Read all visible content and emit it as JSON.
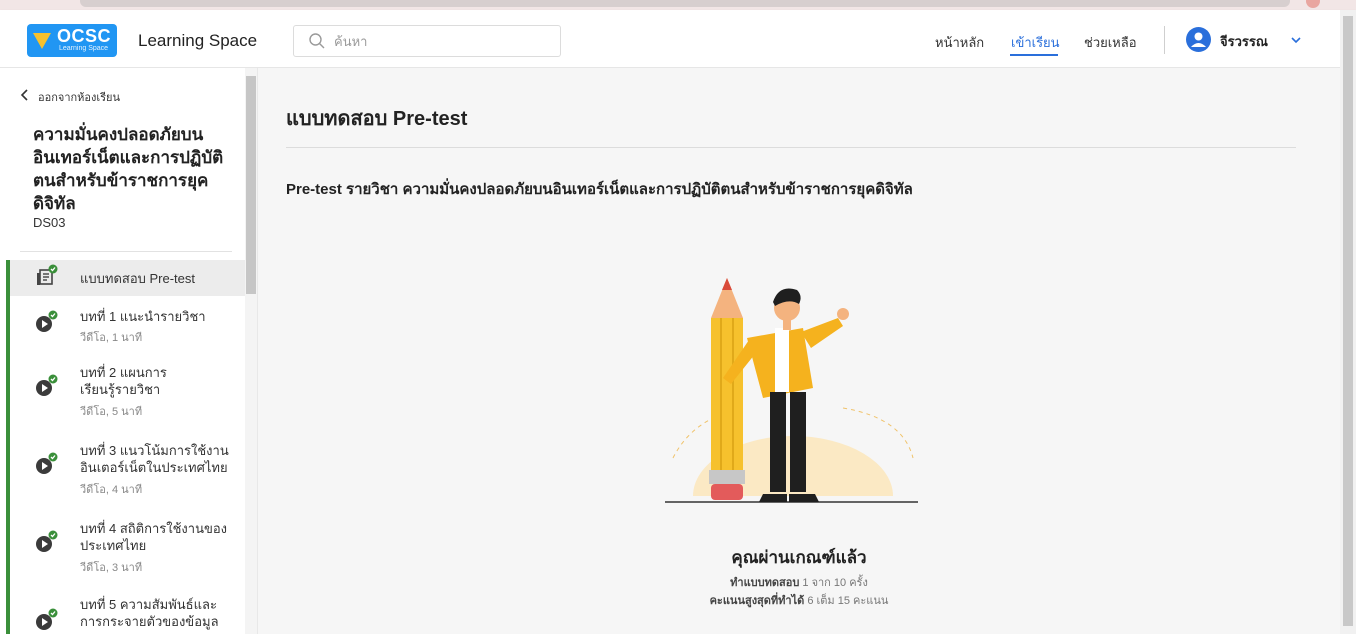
{
  "header": {
    "logo_text": "OCSC",
    "logo_sub": "Learning Space",
    "app_name": "Learning Space",
    "search_placeholder": "ค้นหา",
    "nav": [
      {
        "label": "หน้าหลัก",
        "active": false
      },
      {
        "label": "เข้าเรียน",
        "active": true
      },
      {
        "label": "ช่วยเหลือ",
        "active": false
      }
    ],
    "user_name": "จีรวรรณ"
  },
  "sidebar": {
    "back_label": "ออกจากห้องเรียน",
    "course_title": "ความมั่นคงปลอดภัยบนอินเทอร์เน็ตและการปฏิบัติตนสำหรับข้าราชการยุคดิจิทัล",
    "course_code": "DS03",
    "lessons": [
      {
        "title": "แบบทดสอบ Pre-test",
        "sub": "",
        "type": "quiz",
        "done": true,
        "active": true
      },
      {
        "title": "บทที่ 1 แนะนำรายวิชา",
        "sub": "วีดีโอ, 1 นาที",
        "type": "video",
        "done": true,
        "active": false
      },
      {
        "title": "บทที่ 2 แผนการเรียนรู้รายวิชา",
        "sub": "วีดีโอ, 5 นาที",
        "type": "video",
        "done": true,
        "active": false
      },
      {
        "title": "บทที่ 3 แนวโน้มการใช้งานอินเตอร์เน็ตในประเทศไทย",
        "sub": "วีดีโอ, 4 นาที",
        "type": "video",
        "done": true,
        "active": false
      },
      {
        "title": "บทที่ 4 สถิติการใช้งานของประเทศไทย",
        "sub": "วีดีโอ, 3 นาที",
        "type": "video",
        "done": true,
        "active": false
      },
      {
        "title": "บทที่ 5 ความสัมพันธ์และการกระจายตัวของข้อมูล",
        "sub": "",
        "type": "video",
        "done": true,
        "active": false
      }
    ]
  },
  "main": {
    "title": "แบบทดสอบ Pre-test",
    "subject": "Pre-test รายวิชา ความมั่นคงปลอดภัยบนอินเทอร์เน็ตและการปฏิบัติตนสำหรับข้าราชการยุคดิจิทัล",
    "result_title": "คุณผ่านเกณฑ์แล้ว",
    "attempts_label": "ทำแบบทดสอบ",
    "attempts_value": "1 จาก 10 ครั้ง",
    "score_label": "คะแนนสูงสุดที่ทำได้",
    "score_value": "6 เต็ม 15 คะแนน"
  },
  "colors": {
    "brand_blue": "#2196f3",
    "accent_blue": "#2a6fdb",
    "done_green": "#3a8f3a",
    "illustration_yellow": "#f6c12d"
  }
}
